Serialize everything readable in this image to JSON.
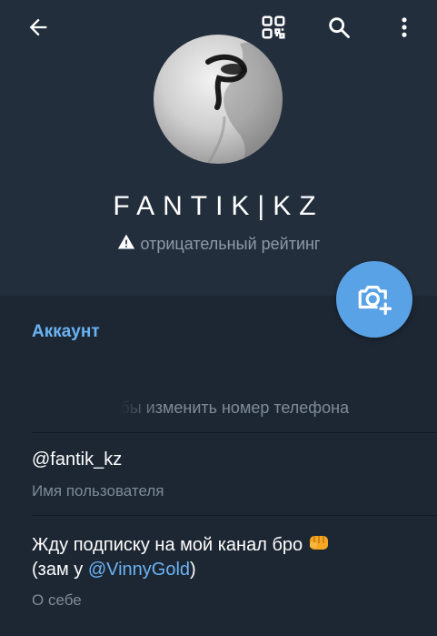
{
  "header": {
    "name": "FANTIK|KZ",
    "status": "отрицательный рейтинг",
    "icons": [
      "back-arrow-icon",
      "qr-code-icon",
      "search-icon",
      "more-vert-icon",
      "warning-icon",
      "add-photo-icon"
    ]
  },
  "account": {
    "section_title": "Аккаунт",
    "phone_hint": "чтобы изменить номер телефона",
    "username": "@fantik_kz",
    "username_label": "Имя пользователя",
    "bio_line1": "Жду подписку на мой канал бро",
    "bio_line2_prefix": "(зам у ",
    "bio_mention": "@VinnyGold",
    "bio_line2_suffix": ")",
    "bio_label": "О себе"
  },
  "colors": {
    "background": "#1d2733",
    "header": "#232e3c",
    "accent": "#6ab3f3",
    "fab": "#5aa2e6",
    "secondary_text": "#7f8b98"
  }
}
